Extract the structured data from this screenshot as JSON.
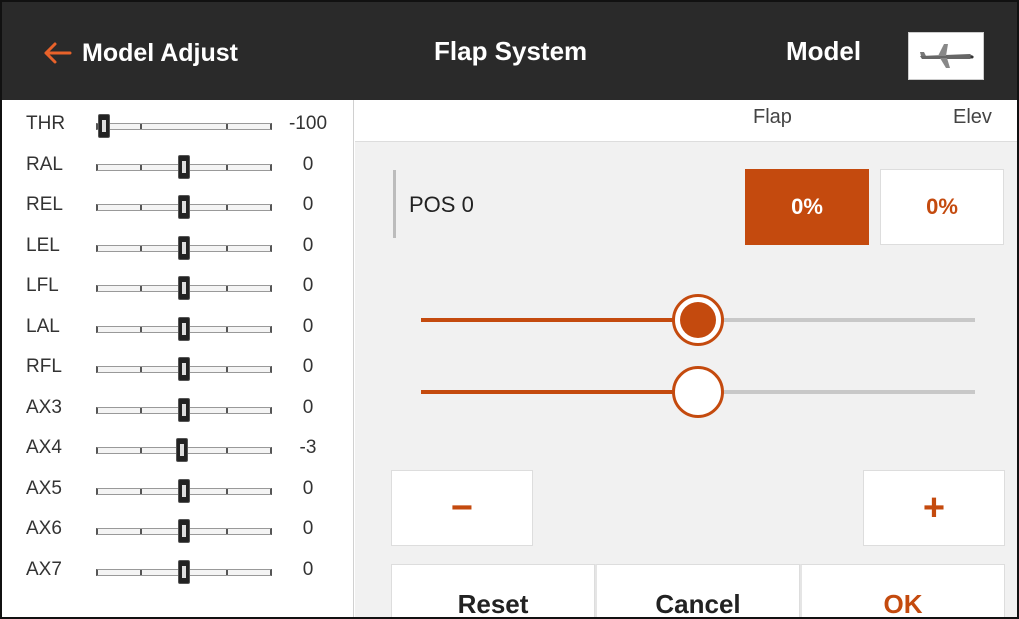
{
  "header": {
    "back_label": "Model Adjust",
    "title": "Flap System",
    "model_label": "Model"
  },
  "colors": {
    "accent": "#c44a0e",
    "header_bg": "#2a2a2a",
    "back_arrow": "#e8622a"
  },
  "channels": [
    {
      "name": "THR",
      "value": "-100",
      "level": -100
    },
    {
      "name": "RAL",
      "value": "0",
      "level": 0
    },
    {
      "name": "REL",
      "value": "0",
      "level": 0
    },
    {
      "name": "LEL",
      "value": "0",
      "level": 0
    },
    {
      "name": "LFL",
      "value": "0",
      "level": 0
    },
    {
      "name": "LAL",
      "value": "0",
      "level": 0
    },
    {
      "name": "RFL",
      "value": "0",
      "level": 0
    },
    {
      "name": "AX3",
      "value": "0",
      "level": 0
    },
    {
      "name": "AX4",
      "value": "-3",
      "level": -3
    },
    {
      "name": "AX5",
      "value": "0",
      "level": 0
    },
    {
      "name": "AX6",
      "value": "0",
      "level": 0
    },
    {
      "name": "AX7",
      "value": "0",
      "level": 0
    }
  ],
  "panel": {
    "col_flap": "Flap",
    "col_elev": "Elev",
    "position_label": "POS 0",
    "flap_value": "0%",
    "elev_value": "0%",
    "flap_slider_level": 0.5,
    "elev_slider_level": 0.5,
    "minus_label": "−",
    "plus_label": "+",
    "reset_label": "Reset",
    "cancel_label": "Cancel",
    "ok_label": "OK"
  }
}
